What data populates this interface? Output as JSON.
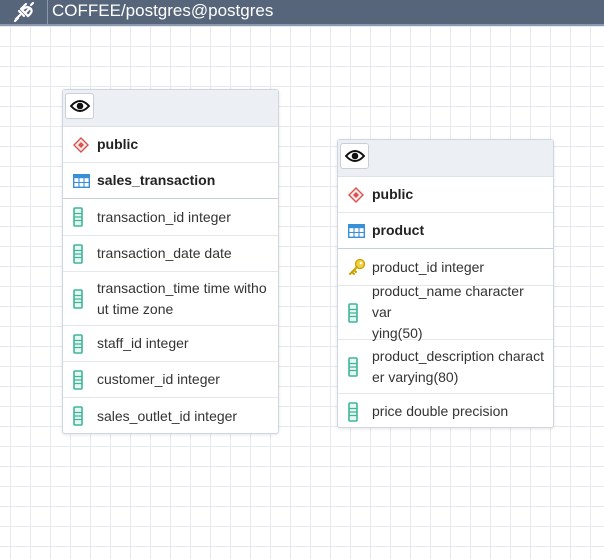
{
  "topbar": {
    "title": "COFFEE/postgres@postgres",
    "icon": "connection-plug-icon"
  },
  "tables": [
    {
      "schema": "public",
      "name": "sales_transaction",
      "columns": [
        {
          "text": "transaction_id integer",
          "icon": "column-icon"
        },
        {
          "text": "transaction_date date",
          "icon": "column-icon"
        },
        {
          "text": "transaction_time time witho\nut time zone",
          "icon": "column-icon"
        },
        {
          "text": "staff_id integer",
          "icon": "column-icon"
        },
        {
          "text": "customer_id integer",
          "icon": "column-icon"
        },
        {
          "text": "sales_outlet_id integer",
          "icon": "column-icon"
        }
      ]
    },
    {
      "schema": "public",
      "name": "product",
      "columns": [
        {
          "text": "product_id integer",
          "icon": "primary-key-icon"
        },
        {
          "text": "product_name character var\nying(50)",
          "icon": "column-icon"
        },
        {
          "text": "product_description charact\ner varying(80)",
          "icon": "column-icon"
        },
        {
          "text": "price double precision",
          "icon": "column-icon"
        }
      ]
    }
  ],
  "colors": {
    "topbar": "#56657a",
    "schema_icon": "#d9534f",
    "table_icon": "#3a8fd6",
    "column_icon": "#3fb59a",
    "key_icon": "#e6b800"
  }
}
